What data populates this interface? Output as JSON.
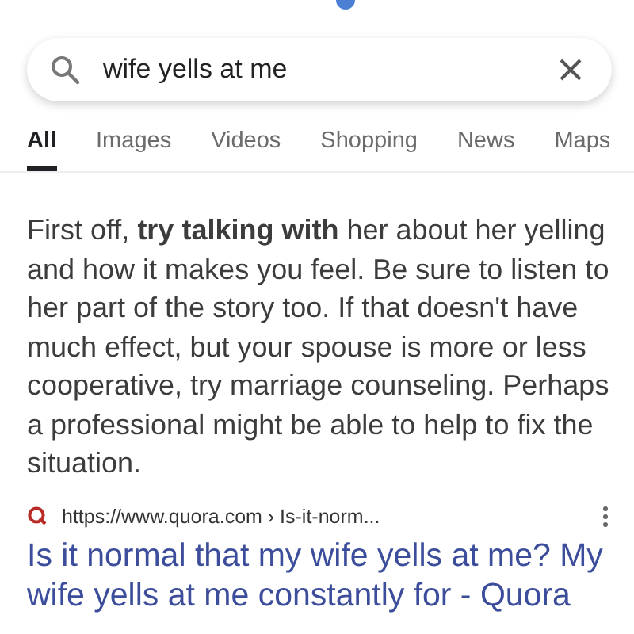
{
  "search": {
    "value": "wife yells at me"
  },
  "tabs": [
    {
      "label": "All",
      "selected": true
    },
    {
      "label": "Images",
      "selected": false
    },
    {
      "label": "Videos",
      "selected": false
    },
    {
      "label": "Shopping",
      "selected": false
    },
    {
      "label": "News",
      "selected": false
    },
    {
      "label": "Maps",
      "selected": false
    }
  ],
  "snippet": "First off, **try talking with** her about her yelling and how it makes you feel. Be sure to listen to her part of the story too. If that doesn't have much effect, but your spouse is more or less cooperative, try marriage counseling. Perhaps a professional might be able to help to fix the situation.",
  "result": {
    "url": "https://www.quora.com › Is-it-norm...",
    "title": "Is it normal that my wife yells at me? My wife yells at me constantly for - Quora"
  }
}
